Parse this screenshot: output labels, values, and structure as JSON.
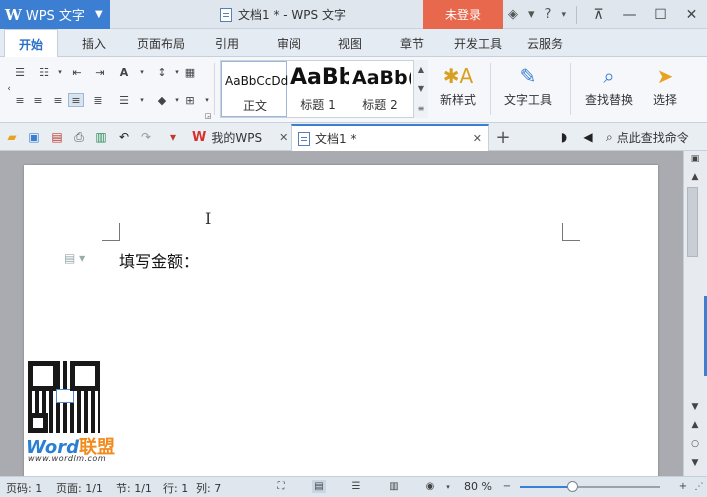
{
  "app": {
    "menu_label": "WPS 文字",
    "logo_glyph": "W",
    "document_title": "文档1 * - WPS 文字",
    "login_label": "未登录"
  },
  "ribbon_tabs": [
    "开始",
    "插入",
    "页面布局",
    "引用",
    "审阅",
    "视图",
    "章节",
    "开发工具",
    "云服务"
  ],
  "styles": [
    {
      "sample": "AaBbCcDd",
      "label": "正文"
    },
    {
      "sample": "AaBb",
      "label": "标题 1"
    },
    {
      "sample": "AaBb(",
      "label": "标题 2"
    }
  ],
  "ribbon_buttons": {
    "new_style": "新样式",
    "text_tools": "文字工具",
    "find_replace": "查找替换",
    "select": "选择"
  },
  "doc_tabs": {
    "my_wps": "我的WPS",
    "doc1": "文档1 *",
    "search_command": "点此查找命令"
  },
  "document": {
    "text": "填写金额：",
    "brand_word": "Word",
    "brand_cn": "联盟",
    "brand_url": "www.wordlm.com"
  },
  "status": {
    "page_num": "页码: 1",
    "page": "页面: 1/1",
    "section": "节: 1/1",
    "row": "行: 1",
    "col": "列: 7",
    "zoom": "80 %",
    "zoom_level": 0.37
  },
  "colors": {
    "accent": "#3c7fd2",
    "login": "#e8684e"
  }
}
